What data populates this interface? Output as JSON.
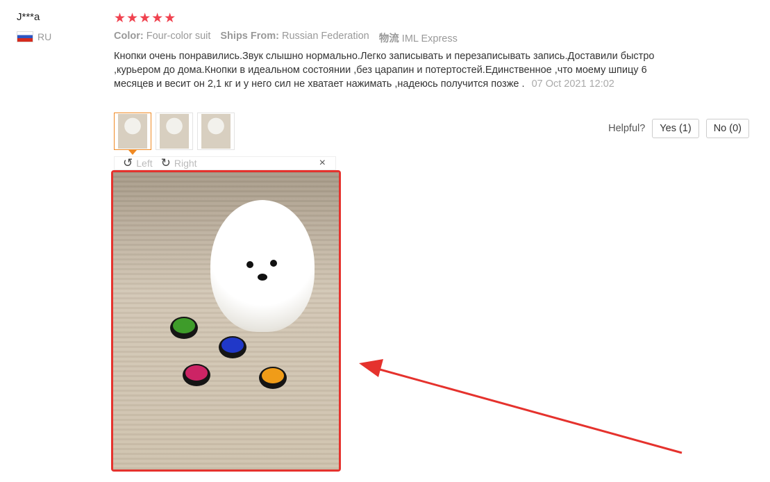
{
  "reviewer": {
    "name": "J***a",
    "country_code": "RU"
  },
  "rating": {
    "stars": "★★★★★"
  },
  "properties": {
    "color_label": "Color:",
    "color_value": "Four-color suit",
    "ships_label": "Ships From:",
    "ships_value": "Russian Federation",
    "logistics_label": "物流",
    "logistics_value": "IML Express"
  },
  "review": {
    "text": "Кнопки очень понравились.Звук слышно нормально.Легко записывать и перезаписывать запись.Доставили быстро ,курьером до дома.Кнопки в идеальном состоянии ,без царапин и потертостей.Единственное ,что моему шпицу 6 месяцев и весит он 2,1 кг и у него сил не хватает нажимать ,надеюсь получится позже .",
    "date": "07 Oct 2021 12:02"
  },
  "helpful": {
    "label": "Helpful?",
    "yes": "Yes (1)",
    "no": "No (0)"
  },
  "viewer": {
    "rotate_left": "Left",
    "rotate_right": "Right",
    "close": "×"
  },
  "icons": {
    "rotate_left": "↺",
    "rotate_right": "↻"
  },
  "colors": {
    "stars": "#f0424f",
    "highlight_border": "#e5322d",
    "arrow": "#e5322d",
    "thumb_active": "#f08a24"
  }
}
